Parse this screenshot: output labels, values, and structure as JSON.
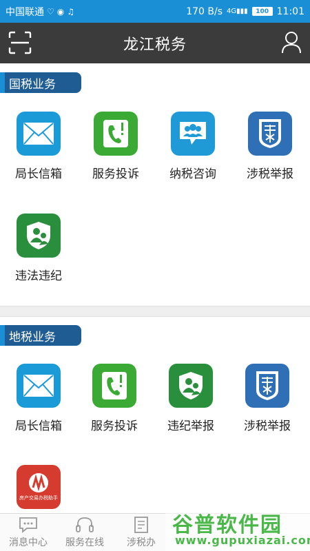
{
  "status_bar": {
    "carrier": "中国联通",
    "speed": "170 B/s",
    "signal": "4G",
    "battery": "100",
    "time": "11:01"
  },
  "header": {
    "title": "龙江税务",
    "scan_icon": "scan-icon",
    "user_icon": "user-icon"
  },
  "national_tax": {
    "title": "国税业务",
    "items": [
      {
        "label": "局长信箱",
        "icon": "mail-icon",
        "color": "#1a9bd8"
      },
      {
        "label": "服务投诉",
        "icon": "phone-complaint-icon",
        "color": "#3aaa35"
      },
      {
        "label": "纳税咨询",
        "icon": "chat-people-icon",
        "color": "#1f9ad6"
      },
      {
        "label": "涉税举报",
        "icon": "tax-report-icon",
        "color": "#2f6fb5"
      },
      {
        "label": "违法违纪",
        "icon": "shield-people-icon",
        "color": "#2a8f3c"
      }
    ]
  },
  "local_tax": {
    "title": "地税业务",
    "items": [
      {
        "label": "局长信箱",
        "icon": "mail-icon",
        "color": "#1a9bd8"
      },
      {
        "label": "服务投诉",
        "icon": "phone-complaint-icon",
        "color": "#3aaa35"
      },
      {
        "label": "违纪举报",
        "icon": "shield-people-icon",
        "color": "#2a8f3c"
      },
      {
        "label": "涉税举报",
        "icon": "tax-report-icon",
        "color": "#2f6fb5"
      },
      {
        "label": "",
        "icon": "property-assistant-icon",
        "color": "#d63b2f",
        "icon_text": "房产交易办税助手"
      }
    ]
  },
  "bottom_nav": [
    {
      "label": "消息中心",
      "icon": "message-icon"
    },
    {
      "label": "服务在线",
      "icon": "headset-icon"
    },
    {
      "label": "涉税办",
      "icon": "document-icon"
    }
  ],
  "watermark": {
    "line1": "谷普软件园",
    "line2": "www.gupuxiazai.com"
  }
}
